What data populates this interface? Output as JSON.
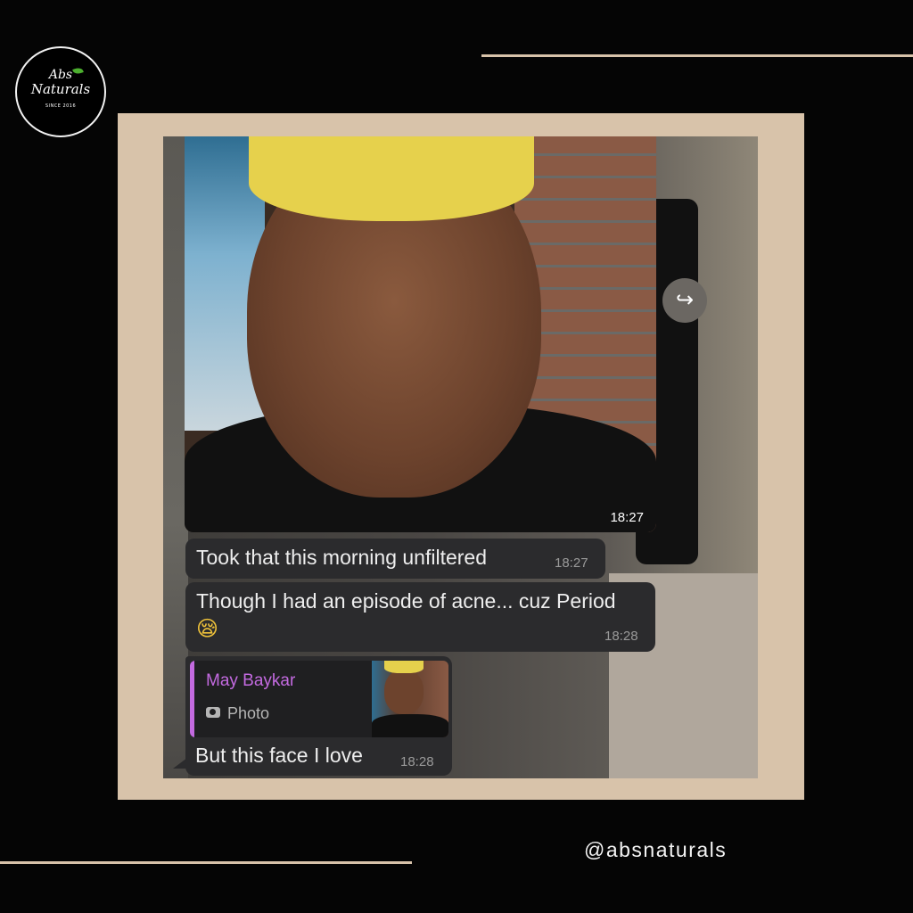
{
  "brand": {
    "logo_line1": "Abs",
    "logo_line2": "Naturals",
    "logo_since": "SINCE 2016",
    "handle": "@absnaturals",
    "accent": "#d8c3aa"
  },
  "chat": {
    "photo_time": "18:27",
    "messages": [
      {
        "text": "Took that this morning unfiltered",
        "time": "18:27"
      },
      {
        "text": "Though I had an episode of acne... cuz Period",
        "emoji": "😪",
        "time": "18:28"
      }
    ],
    "reply": {
      "quoted_name": "May Baykar",
      "quoted_type": "Photo",
      "text": "But this face I love",
      "time": "18:28"
    },
    "forward_icon": "↪",
    "colors": {
      "bubble": "#2b2b2d",
      "quote_name": "#c36ae0"
    }
  }
}
